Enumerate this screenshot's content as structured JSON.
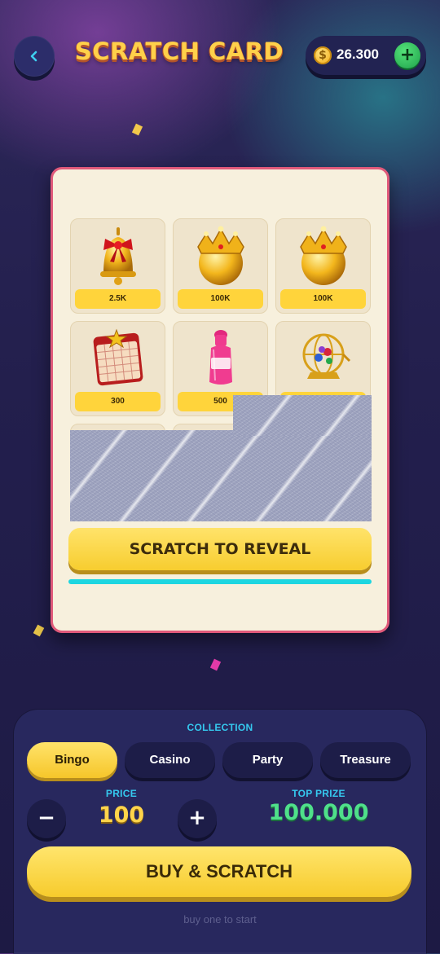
{
  "header": {
    "back_icon": "chevron-left-icon",
    "title": "SCRATCH CARD",
    "balance": {
      "currency_symbol": "$",
      "value": "26.300",
      "add_label": "+"
    }
  },
  "card": {
    "prizes": [
      {
        "icon": "bell-icon",
        "label": "2.5K"
      },
      {
        "icon": "crown-icon",
        "label": "100K"
      },
      {
        "icon": "crown-icon",
        "label": "100K"
      },
      {
        "icon": "bingo-card-icon",
        "label": "300"
      },
      {
        "icon": "dauber-marker-icon",
        "label": "500"
      },
      {
        "icon": "bingo-cage-icon",
        "label": ""
      }
    ],
    "reveal_button": "SCRATCH TO REVEAL",
    "progress": 1.0
  },
  "panel": {
    "collection_label": "COLLECTION",
    "tabs": [
      {
        "label": "Bingo",
        "active": true
      },
      {
        "label": "Casino",
        "active": false
      },
      {
        "label": "Party",
        "active": false
      },
      {
        "label": "Treasure",
        "active": false
      }
    ],
    "price_label": "PRICE",
    "price_value": "100",
    "decrease_label": "−",
    "increase_label": "+",
    "top_prize_label": "TOP PRIZE",
    "top_prize_value": "100.000",
    "buy_button": "BUY & SCRATCH",
    "hint": "buy one to start"
  },
  "colors": {
    "accent_yellow": "#ffd43b",
    "card_border": "#e0597a",
    "progress": "#1ed6e0",
    "prize_green": "#4fe08a",
    "label_cyan": "#35c9ef"
  }
}
